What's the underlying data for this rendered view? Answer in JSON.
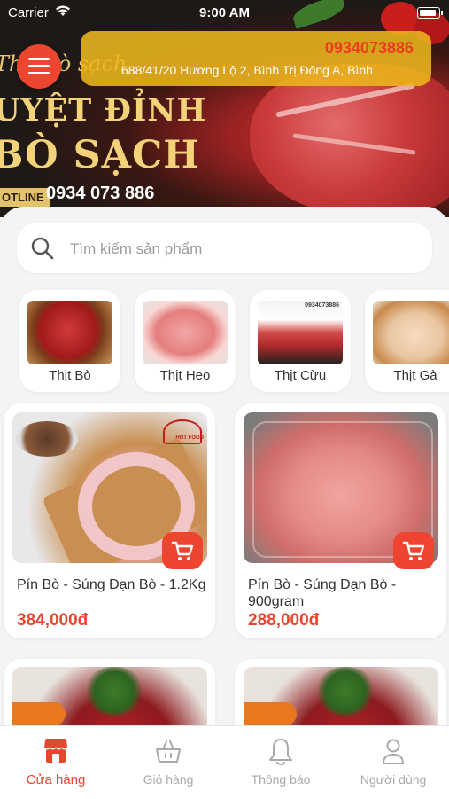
{
  "status_bar": {
    "carrier": "Carrier",
    "time": "9:00 AM"
  },
  "banner": {
    "script_text": "Thịt bò sạch",
    "headline_1": "UYỆT ĐỈNH",
    "headline_2": "BÒ SẠCH",
    "hotline_tag": "OTLINE",
    "hotline_number": "0934 073 886"
  },
  "header": {
    "phone": "0934073886",
    "address": "688/41/20 Hương Lộ 2, Bình Trị Đông A, Bình"
  },
  "search": {
    "placeholder": "Tìm kiếm sản phẩm",
    "value": ""
  },
  "categories": [
    {
      "label": "Thịt Bò"
    },
    {
      "label": "Thịt Heo"
    },
    {
      "label": "Thịt Cừu",
      "image_text": "0934073886"
    },
    {
      "label": "Thịt Gà"
    }
  ],
  "products": [
    {
      "name": "Pín Bò - Súng Đạn Bò - 1.2Kg",
      "price": "384,000đ",
      "image_text": "HOT FOOD"
    },
    {
      "name": "Pín Bò - Súng Đạn Bò - 900gram",
      "price": "288,000đ"
    }
  ],
  "tabs": [
    {
      "label": "Cửa hàng",
      "icon": "store-icon",
      "active": true
    },
    {
      "label": "Giỏ hàng",
      "icon": "basket-icon",
      "active": false
    },
    {
      "label": "Thông báo",
      "icon": "bell-icon",
      "active": false
    },
    {
      "label": "Người dùng",
      "icon": "user-icon",
      "active": false
    }
  ],
  "colors": {
    "accent": "#E8452F",
    "header_bar": "#ECB61E",
    "tab_inactive": "#A9A9A9"
  }
}
